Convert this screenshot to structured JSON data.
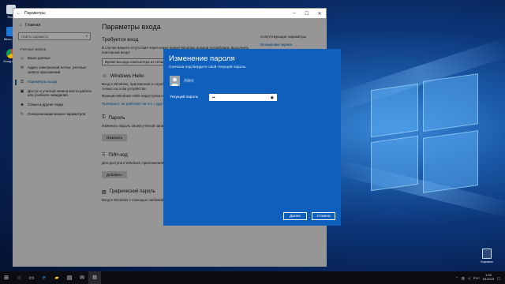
{
  "desktop": {
    "icons": [
      {
        "name": "Recycle",
        "label": "Recy"
      },
      {
        "name": "Microsoft Edge",
        "label": "Micro Edg"
      },
      {
        "name": "Google Chrome",
        "label": "Goog Chro"
      }
    ],
    "recycle_label": "Корзина"
  },
  "settings_window": {
    "title": "Параметры",
    "sidebar": {
      "home": "Главная",
      "search_placeholder": "Найти параметр",
      "section": "Учетные записи",
      "items": [
        {
          "label": "Ваши данные",
          "icon": "person-icon"
        },
        {
          "label": "Адрес электронной почты; учетные записи приложений",
          "icon": "mail-icon"
        },
        {
          "label": "Параметры входа",
          "icon": "key-icon"
        },
        {
          "label": "Доступ к учетной записи места работы или учебного заведения",
          "icon": "briefcase-icon"
        },
        {
          "label": "Семья и другие люди",
          "icon": "people-icon"
        },
        {
          "label": "Синхронизация ваших параметров",
          "icon": "sync-icon"
        }
      ]
    },
    "main": {
      "page_title": "Параметры входа",
      "require_signin_heading": "Требуется вход",
      "require_signin_text": "В случае вашего отсутствия через какое время Windows должна потребовать выполнить повторный вход?",
      "require_signin_value": "Время выхода компьютера из спящего режима",
      "windows_hello_heading": "Windows Hello",
      "windows_hello_text": "Вход в Windows, приложения и службы с помощью Windows Hello. Windows расположено только на этом устройстве.",
      "windows_hello_text2": "Функция Windows Hello недоступна на этом устройстве.",
      "windows_hello_link": "Проверьте, не работает ли это с другими устройствами",
      "password_heading": "Пароль",
      "password_text": "Изменить пароль своей учетной записи",
      "password_button": "Изменить",
      "pin_heading": "ПИН-код",
      "pin_text": "Для доступа к Windows, приложениям и службам можно использовать ПИН-код.",
      "pin_button": "Добавить",
      "picture_heading": "Графический пароль",
      "picture_text": "Вход в Windows с помощью любимой фотографии"
    },
    "right_col": {
      "heading": "Сопутствующие параметры",
      "link": "Блокировка экрана"
    }
  },
  "dialog": {
    "title": "Изменение пароля",
    "subtitle": "Сначала подтвердите свой текущий пароль.",
    "user_name": "Alex",
    "password_label": "Текущий пароль",
    "password_value": "••",
    "next_button": "Далее",
    "cancel_button": "Отмена"
  },
  "taskbar": {
    "time": "1:30",
    "date": "04.2019",
    "lang": "РУС"
  }
}
